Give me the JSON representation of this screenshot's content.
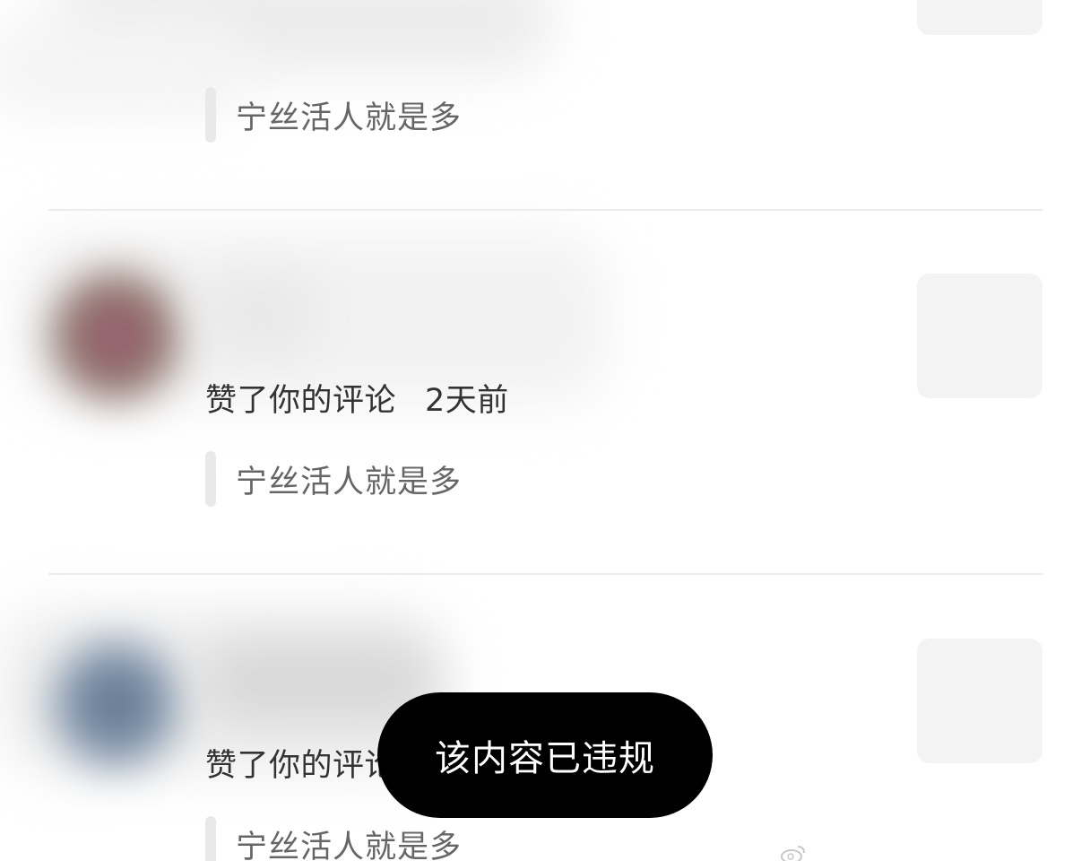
{
  "items": [
    {
      "quote": "宁丝活人就是多"
    },
    {
      "action": "赞了你的评论",
      "time": "2天前",
      "quote": "宁丝活人就是多"
    },
    {
      "action": "赞了你的评论",
      "time": "",
      "quote": "宁丝活人就是多"
    }
  ],
  "toast": {
    "message": "该内容已违规"
  },
  "watermark": {
    "icon": "weibo-logo",
    "text": ""
  },
  "colors": {
    "avatar_2": "#8e5a6c",
    "avatar_3": "#5d6f86",
    "toast_bg": "#000000",
    "quote_text": "#666666",
    "action_text": "#333333"
  }
}
